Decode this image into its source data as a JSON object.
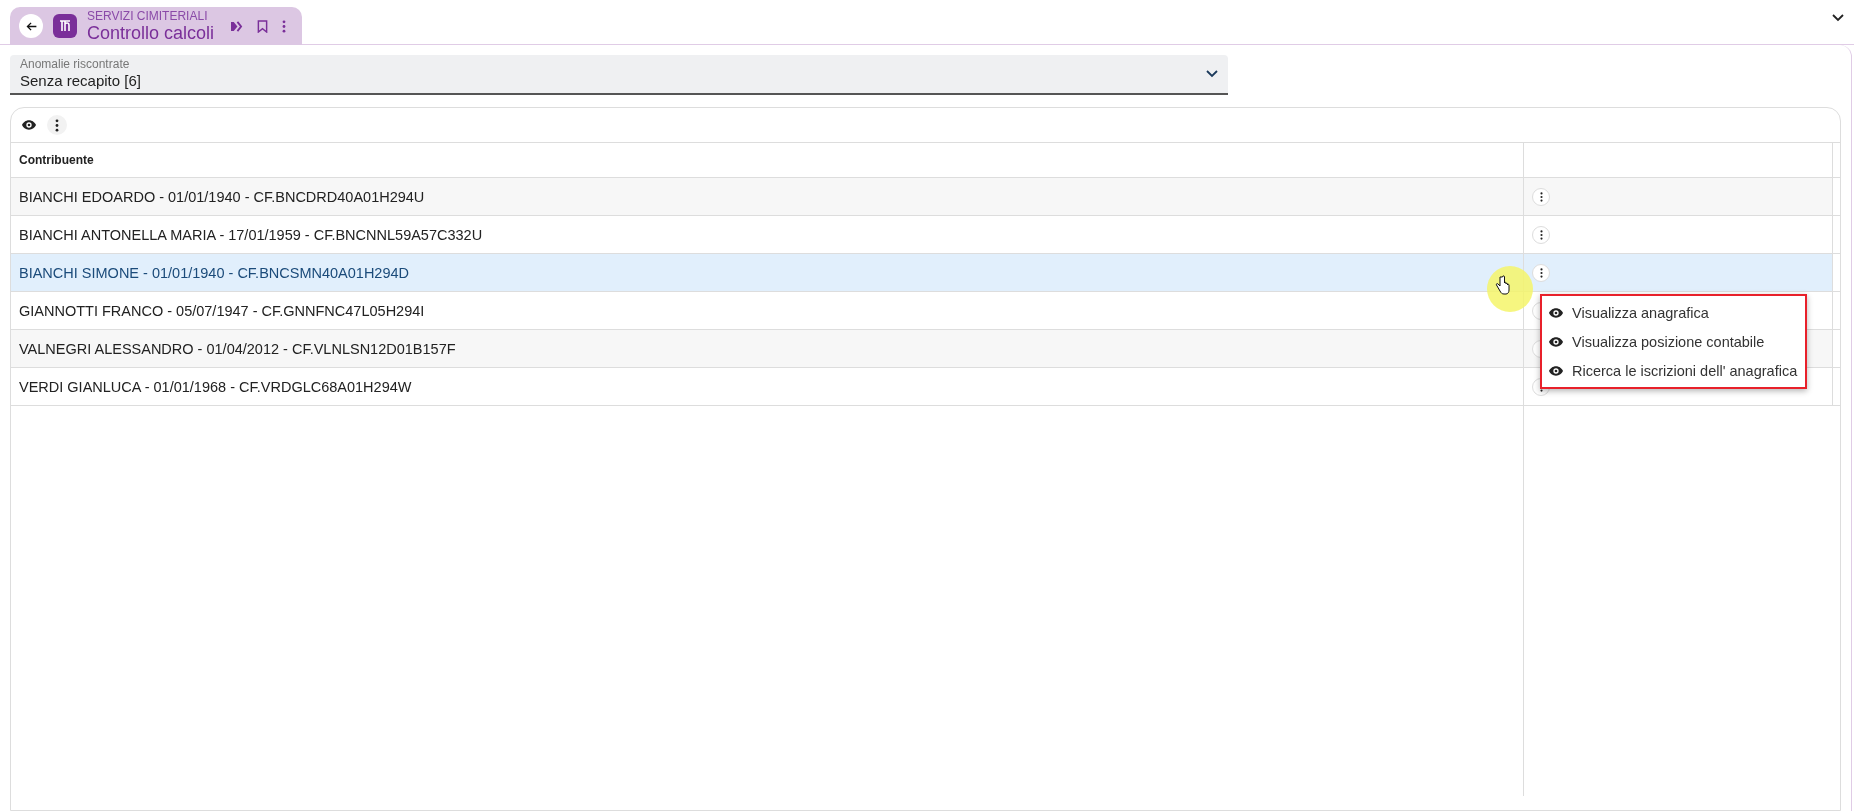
{
  "tab": {
    "subtitle": "SERVIZI CIMITERIALI",
    "title": "Controllo calcoli"
  },
  "filter": {
    "label": "Anomalie riscontrate",
    "value": "Senza recapito [6]"
  },
  "table": {
    "columns": [
      "Contribuente"
    ],
    "rows": [
      {
        "text": "BIANCHI EDOARDO - 01/01/1940 - CF.BNCDRD40A01H294U",
        "selected": false
      },
      {
        "text": "BIANCHI ANTONELLA MARIA - 17/01/1959 - CF.BNCNNL59A57C332U",
        "selected": false
      },
      {
        "text": "BIANCHI SIMONE - 01/01/1940 - CF.BNCSMN40A01H294D",
        "selected": true
      },
      {
        "text": "GIANNOTTI FRANCO - 05/07/1947 - CF.GNNFNC47L05H294I",
        "selected": false
      },
      {
        "text": "VALNEGRI ALESSANDRO - 01/04/2012 - CF.VLNLSN12D01B157F",
        "selected": false
      },
      {
        "text": "VERDI GIANLUCA - 01/01/1968 - CF.VRDGLC68A01H294W",
        "selected": false
      }
    ]
  },
  "context_menu": {
    "items": [
      {
        "label": "Visualizza anagrafica"
      },
      {
        "label": "Visualizza posizione contabile"
      },
      {
        "label": "Ricerca le iscrizioni dell' anagrafica"
      }
    ]
  }
}
